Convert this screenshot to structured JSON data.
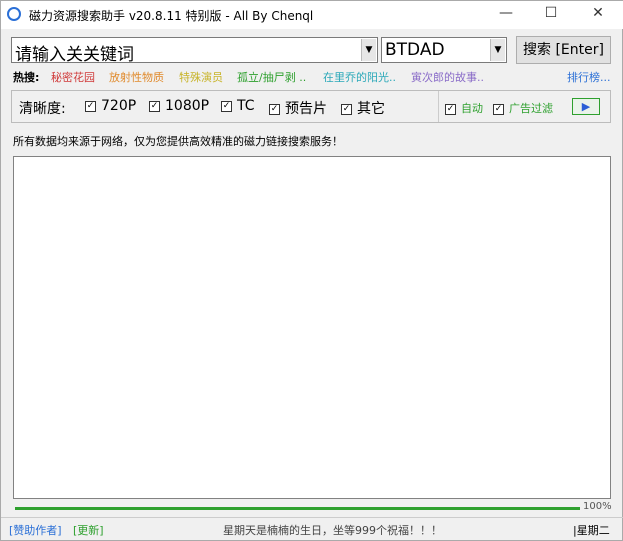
{
  "window": {
    "title": "磁力资源搜索助手 v20.8.11 特别版 - All By Chenql",
    "minimize": "—",
    "maximize": "☐",
    "close": "✕"
  },
  "search": {
    "keyword_placeholder": "请输入关关键词",
    "source": "BTDAD",
    "button": "搜索 [Enter]"
  },
  "hot": {
    "label": "热搜:",
    "items": [
      {
        "text": "秘密花园",
        "color": "#d03a3a"
      },
      {
        "text": "放射性物质",
        "color": "#e08a2c"
      },
      {
        "text": "特殊演员",
        "color": "#c8b42a"
      },
      {
        "text": "孤立/抽尸剥 ..",
        "color": "#2ea02e"
      },
      {
        "text": "在里乔的阳光..",
        "color": "#2aa8b8"
      },
      {
        "text": "寅次郎的故事..",
        "color": "#8a6cc8"
      }
    ],
    "ranking": "排行榜..."
  },
  "quality": {
    "label": "清晰度:",
    "options": [
      {
        "label": "720P",
        "checked": true
      },
      {
        "label": "1080P",
        "checked": true
      },
      {
        "label": "TC",
        "checked": true
      },
      {
        "label": "预告片",
        "checked": true
      },
      {
        "label": "其它",
        "checked": true
      }
    ],
    "auto": "自动",
    "adfilter": "广告过滤"
  },
  "notice": "所有数据均来源于网络，仅为您提供高效精准的磁力链接搜索服务！",
  "progress": {
    "value": 100,
    "label": "100%"
  },
  "status": {
    "sponsor": "[赞助作者]",
    "update": "[更新]",
    "message": "星期天是楠楠的生日，坐等999个祝福！！！",
    "day": "|星期二"
  }
}
